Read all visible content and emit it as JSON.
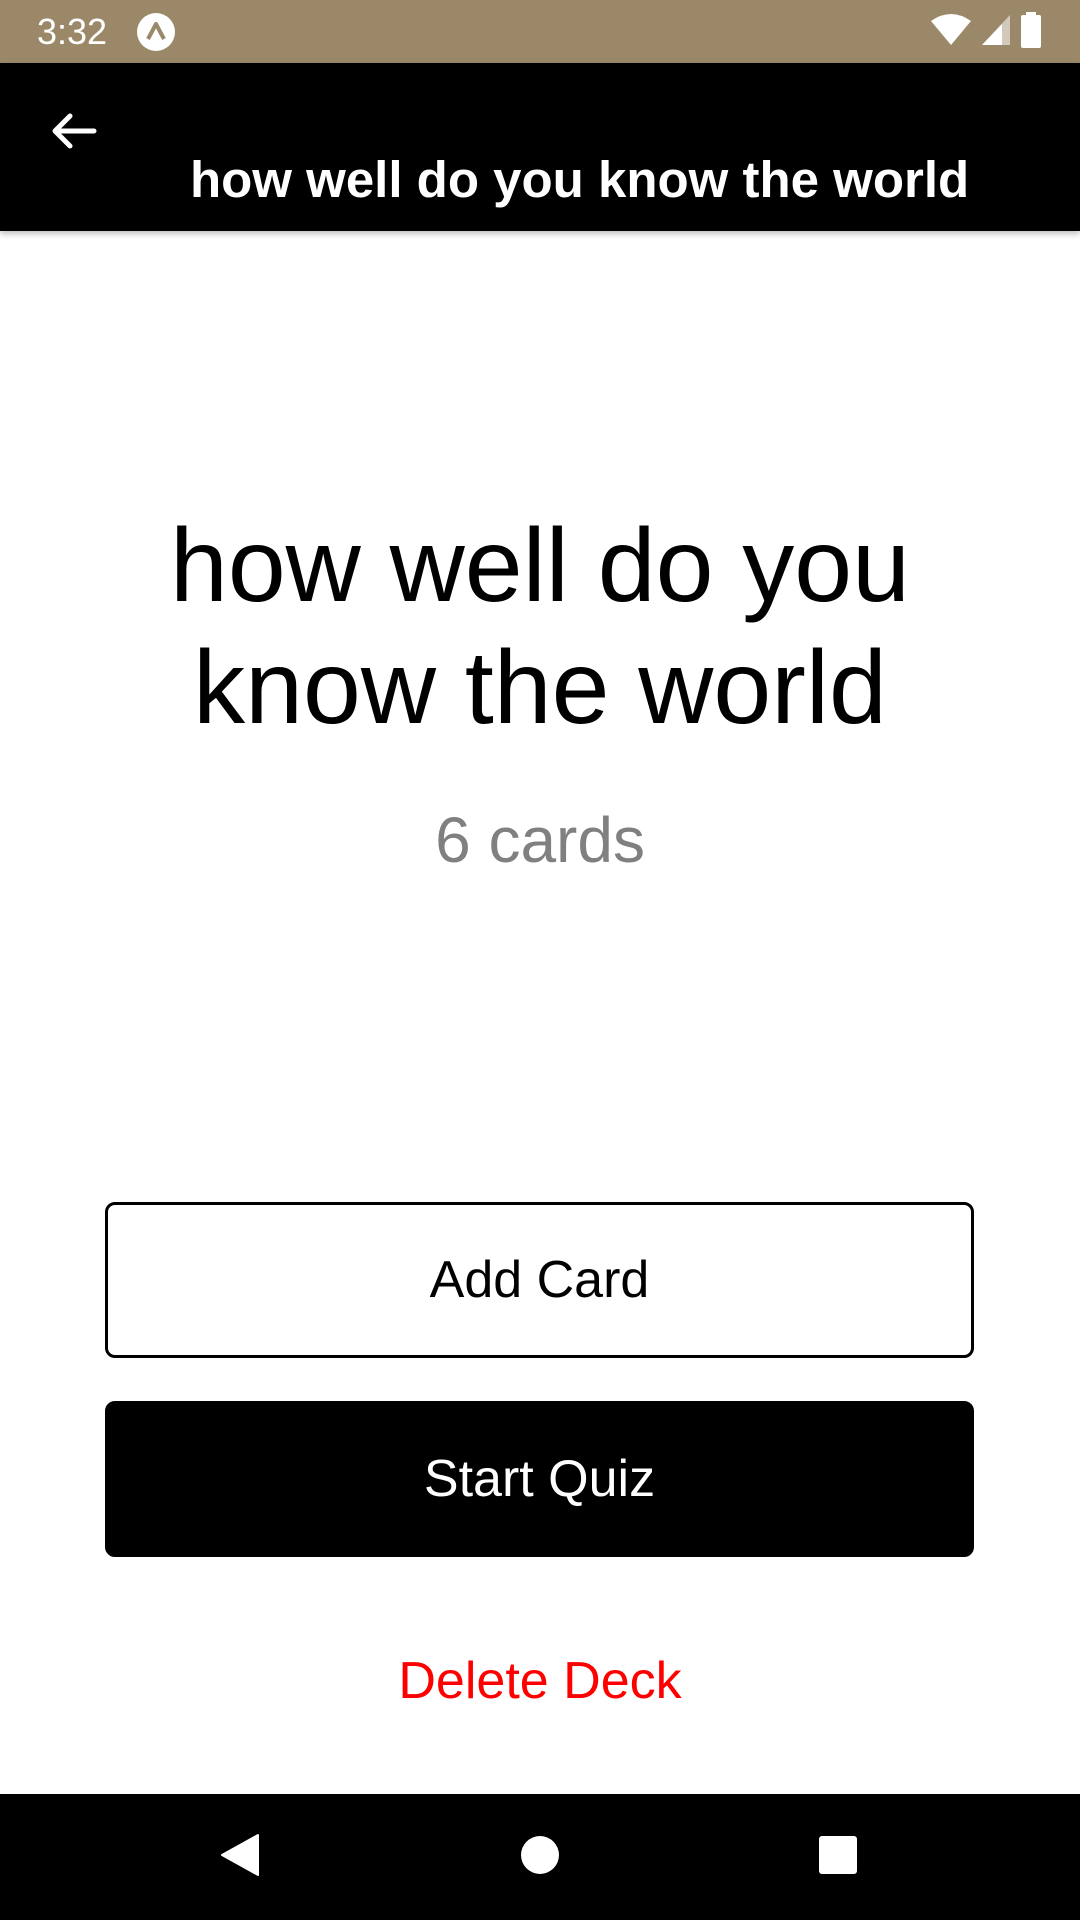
{
  "status_bar": {
    "time": "3:32",
    "background_color": "#9b8868",
    "icons": [
      "app-notification-icon",
      "wifi-icon",
      "cellular-signal-icon",
      "battery-icon"
    ]
  },
  "app_bar": {
    "title": "how well do you know the world",
    "back_icon": "arrow-back-icon"
  },
  "deck": {
    "title": "how well do you know the world",
    "card_count": "6 cards"
  },
  "actions": {
    "add_card_label": "Add Card",
    "start_quiz_label": "Start Quiz",
    "delete_deck_label": "Delete Deck"
  },
  "colors": {
    "delete": "#ff0000",
    "count_text": "#808080",
    "primary": "#000000"
  },
  "nav_bar": {
    "icons": [
      "back-triangle-icon",
      "home-circle-icon",
      "recents-square-icon"
    ]
  }
}
